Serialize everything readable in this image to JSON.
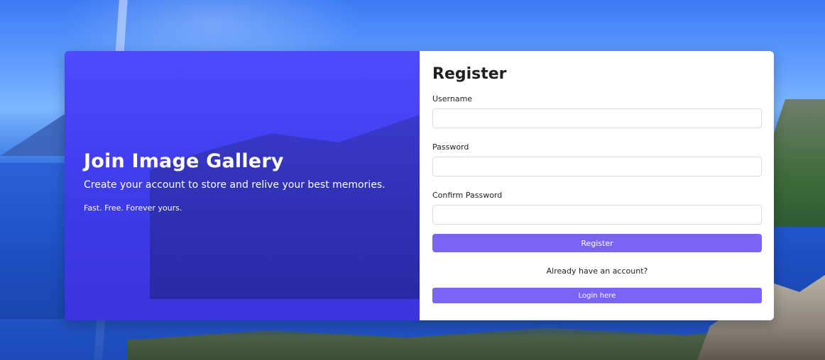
{
  "hero": {
    "title": "Join Image Gallery",
    "subtitle": "Create your account to store and relive your best memories.",
    "tagline": "Fast. Free. Forever yours."
  },
  "form": {
    "title": "Register",
    "username_label": "Username",
    "username_value": "",
    "password_label": "Password",
    "password_value": "",
    "confirm_label": "Confirm Password",
    "confirm_value": "",
    "register_button": "Register",
    "already_text": "Already have an account?",
    "login_button": "Login here"
  },
  "colors": {
    "hero_overlay": "#463cff",
    "button": "#7b63f6"
  }
}
